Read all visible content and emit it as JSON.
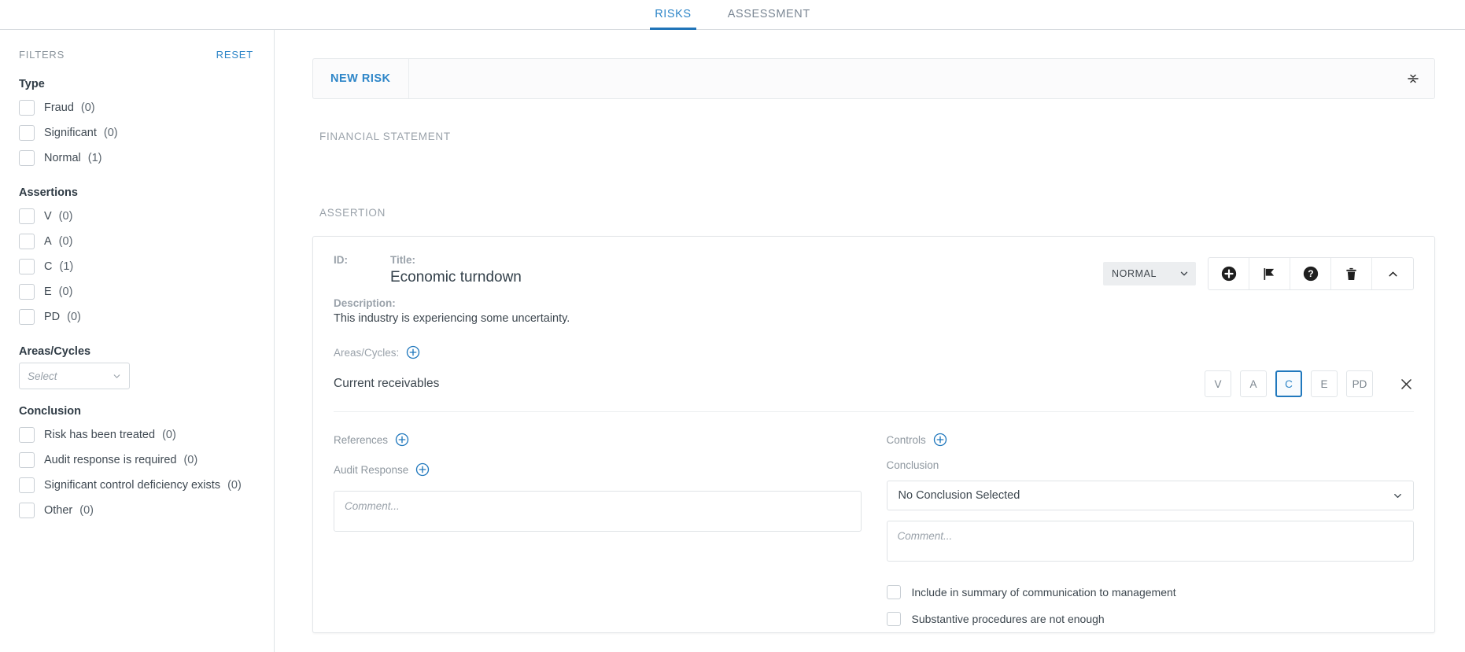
{
  "topbar": {
    "tabs": [
      {
        "label": "RISKS",
        "active": true
      },
      {
        "label": "ASSESSMENT",
        "active": false
      }
    ]
  },
  "sidebar": {
    "filters_title": "FILTERS",
    "reset_label": "RESET",
    "groups": [
      {
        "title": "Type",
        "items": [
          {
            "label": "Fraud",
            "count": "(0)"
          },
          {
            "label": "Significant",
            "count": "(0)"
          },
          {
            "label": "Normal",
            "count": "(1)"
          }
        ]
      },
      {
        "title": "Assertions",
        "items": [
          {
            "label": "V",
            "count": "(0)"
          },
          {
            "label": "A",
            "count": "(0)"
          },
          {
            "label": "C",
            "count": "(1)"
          },
          {
            "label": "E",
            "count": "(0)"
          },
          {
            "label": "PD",
            "count": "(0)"
          }
        ]
      }
    ],
    "areas": {
      "title": "Areas/Cycles",
      "select_placeholder": "Select"
    },
    "conclusion": {
      "title": "Conclusion",
      "items": [
        {
          "label": "Risk has been treated",
          "count": "(0)"
        },
        {
          "label": "Audit response is required",
          "count": "(0)"
        },
        {
          "label": "Significant control deficiency exists",
          "count": "(0)"
        },
        {
          "label": "Other",
          "count": "(0)"
        }
      ]
    }
  },
  "main": {
    "toolbar": {
      "new_risk_label": "NEW RISK",
      "collapse_all_icon": "collapse-all-icon"
    },
    "financial_statement_label": "FINANCIAL STATEMENT",
    "assertion_label": "ASSERTION",
    "risk": {
      "id_key": "ID:",
      "id_value": "",
      "title_key": "Title:",
      "title_value": "Economic turndown",
      "description_key": "Description:",
      "description_value": "This industry is experiencing some uncertainty.",
      "type_value": "NORMAL",
      "actions": [
        {
          "name": "add-icon"
        },
        {
          "name": "flag-icon"
        },
        {
          "name": "help-icon"
        },
        {
          "name": "delete-icon"
        },
        {
          "name": "collapse-icon"
        }
      ],
      "areas_key": "Areas/Cycles:",
      "areas": [
        {
          "name": "Current receivables",
          "assertions": [
            {
              "label": "V",
              "selected": false
            },
            {
              "label": "A",
              "selected": false
            },
            {
              "label": "C",
              "selected": true
            },
            {
              "label": "E",
              "selected": false
            },
            {
              "label": "PD",
              "selected": false
            }
          ]
        }
      ],
      "references_label": "References",
      "audit_response_label": "Audit Response",
      "audit_response_placeholder": "Comment...",
      "audit_response_value": "",
      "controls_label": "Controls",
      "conclusion_label": "Conclusion",
      "conclusion_value": "No Conclusion Selected",
      "conclusion_comment_placeholder": "Comment...",
      "conclusion_comment_value": "",
      "checkboxes": [
        {
          "label": "Include in summary of communication to management",
          "checked": false
        },
        {
          "label": "Substantive procedures are not enough",
          "checked": false
        }
      ]
    }
  },
  "colors": {
    "accent": "#2e86c8",
    "accent_dark": "#2074b8",
    "border": "#dfe3e6",
    "muted_text": "#9aa2aa"
  }
}
